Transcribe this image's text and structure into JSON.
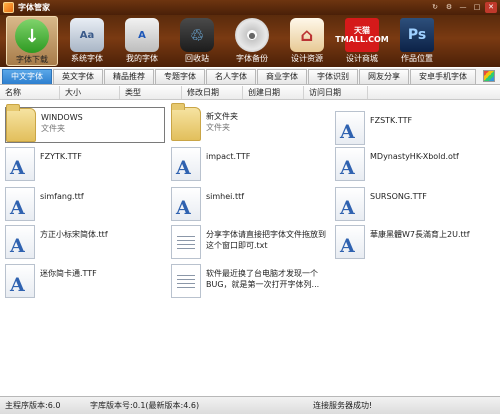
{
  "window": {
    "title": "字体管家",
    "controls": [
      "↻",
      "⚙",
      "—",
      "□",
      "✕"
    ]
  },
  "toolbar": {
    "items": [
      {
        "label": "字体下载",
        "icon": "download-icon",
        "glyph": "↓"
      },
      {
        "label": "系统字体",
        "icon": "system-fonts-icon",
        "glyph": "Aa"
      },
      {
        "label": "我的字体",
        "icon": "my-fonts-icon",
        "glyph": "A"
      },
      {
        "label": "回收站",
        "icon": "recycle-bin-icon",
        "glyph": "♲"
      },
      {
        "label": "字体备份",
        "icon": "backup-disc-icon",
        "glyph": "●"
      },
      {
        "label": "设计资源",
        "icon": "house-icon",
        "glyph": "⌂"
      },
      {
        "label": "设计商城",
        "icon": "tmall-icon",
        "glyph": "天猫\nTMALL.COM"
      },
      {
        "label": "作品位置",
        "icon": "photoshop-icon",
        "glyph": "Ps"
      }
    ]
  },
  "tabs": [
    "中文字体",
    "英文字体",
    "精品推荐",
    "专题字体",
    "名人字体",
    "商业字体",
    "字体识别",
    "网友分享",
    "安卓手机字体"
  ],
  "columns": [
    "名称",
    "大小",
    "类型",
    "修改日期",
    "创建日期",
    "访问日期"
  ],
  "files": [
    {
      "name": "WINDOWS",
      "sub": "文件夹",
      "kind": "folder"
    },
    {
      "name": "新文件夹",
      "sub": "文件夹",
      "kind": "folder"
    },
    {
      "name": "FZSTK.TTF",
      "sub": "",
      "kind": "font"
    },
    {
      "name": "FZYTK.TTF",
      "sub": "",
      "kind": "font"
    },
    {
      "name": "impact.TTF",
      "sub": "",
      "kind": "font"
    },
    {
      "name": "MDynastyHK-Xbold.otf",
      "sub": "",
      "kind": "font"
    },
    {
      "name": "simfang.ttf",
      "sub": "",
      "kind": "font"
    },
    {
      "name": "simhei.ttf",
      "sub": "",
      "kind": "font"
    },
    {
      "name": "SURSONG.TTF",
      "sub": "",
      "kind": "font"
    },
    {
      "name": "方正小标宋简体.ttf",
      "sub": "",
      "kind": "font"
    },
    {
      "name": "分享字体请直接把字体文件拖放到这个窗口即可.txt",
      "sub": "",
      "kind": "txt"
    },
    {
      "name": "華康黑體W7長滿育上2U.ttf",
      "sub": "",
      "kind": "font"
    },
    {
      "name": "迷你简卡通.TTF",
      "sub": "",
      "kind": "font"
    },
    {
      "name": "软件最近换了台电脑才发现一个BUG，就是第一次打开字体列...",
      "sub": "",
      "kind": "txt"
    }
  ],
  "status": {
    "main_version": "主程序版本:6.0",
    "lib_version": "字库版本号:0.1(最新版本:4.6)",
    "server": "连接服务器成功!"
  }
}
